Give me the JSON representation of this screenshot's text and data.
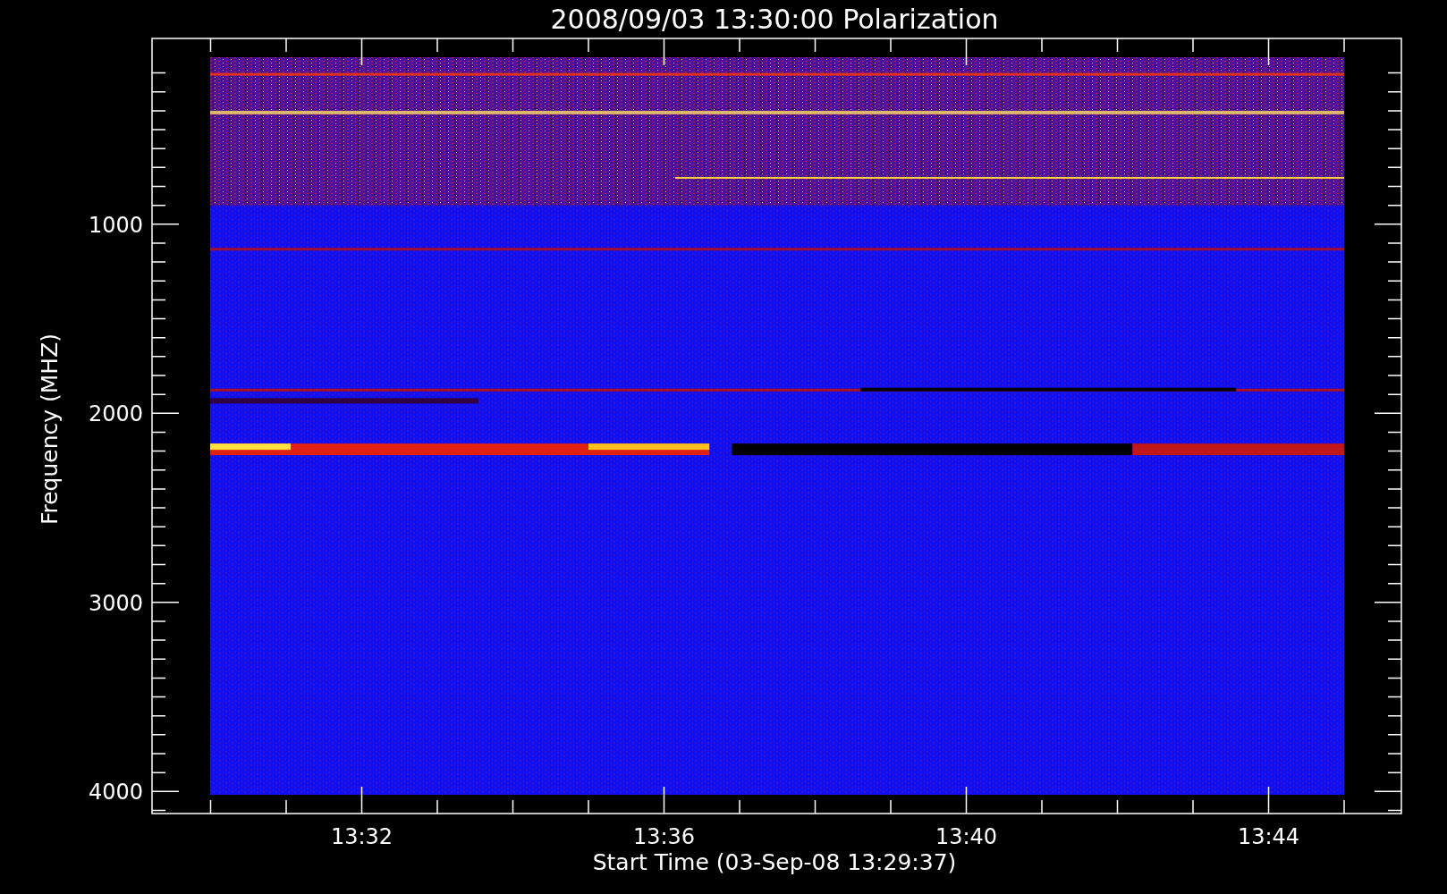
{
  "title": "2008/09/03 13:30:00 Polarization",
  "xlabel": "Start Time (03-Sep-08 13:29:37)",
  "ylabel": "Frequency (MHZ)",
  "xticks": [
    "13:32",
    "13:36",
    "13:40",
    "13:44"
  ],
  "yticks": [
    "1000",
    "2000",
    "3000",
    "4000"
  ]
}
